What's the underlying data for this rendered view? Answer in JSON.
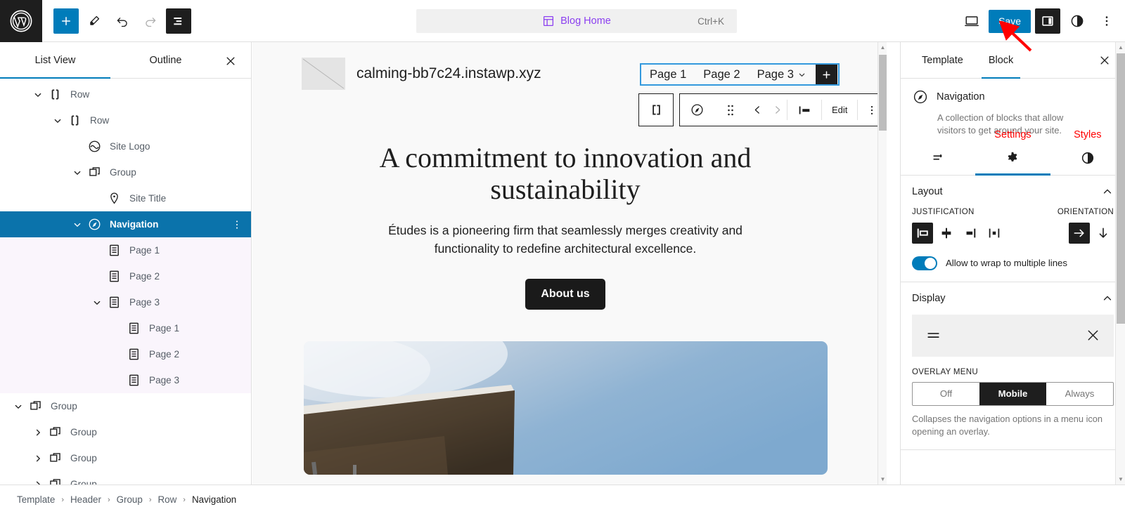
{
  "topbar": {
    "logo_icon": "wordpress-logo-icon",
    "add_block_icon": "plus-icon",
    "tools_icon": "pencil-icon",
    "undo_icon": "undo-arrow-icon",
    "redo_icon": "redo-arrow-icon",
    "list_view_icon": "list-view-icon",
    "document_title": "Blog Home",
    "document_icon": "template-layout-icon",
    "shortcut": "Ctrl+K",
    "view_icon": "desktop-preview-icon",
    "save_label": "Save",
    "settings_toggle_icon": "sidebar-panel-icon",
    "styles_icon": "contrast-half-circle-icon",
    "options_icon": "three-dots-vertical-icon",
    "accent_color": "#007cba",
    "dark_color": "#1e1e1e"
  },
  "list_view": {
    "tabs": [
      {
        "label": "List View",
        "active": true
      },
      {
        "label": "Outline",
        "active": false
      }
    ],
    "close_icon": "close-x-icon",
    "selected_color": "#0b73ab",
    "child_highlight_color": "#faf5fc",
    "rows": [
      {
        "label": "Row",
        "icon": "row-block-icon",
        "indent": 1,
        "chevron": "down",
        "state": "normal"
      },
      {
        "label": "Row",
        "icon": "row-block-icon",
        "indent": 2,
        "chevron": "down",
        "state": "normal"
      },
      {
        "label": "Site Logo",
        "icon": "site-logo-icon",
        "indent": 3,
        "chevron": "none",
        "state": "normal"
      },
      {
        "label": "Group",
        "icon": "group-block-icon",
        "indent": 3,
        "chevron": "down",
        "state": "normal"
      },
      {
        "label": "Site Title",
        "icon": "site-title-pin-icon",
        "indent": 4,
        "chevron": "none",
        "state": "normal"
      },
      {
        "label": "Navigation",
        "icon": "navigation-compass-icon",
        "indent": 3,
        "chevron": "down",
        "state": "selected",
        "more_icon": "three-dots-vertical-icon"
      },
      {
        "label": "Page 1",
        "icon": "page-document-icon",
        "indent": 4,
        "chevron": "none",
        "state": "childsel"
      },
      {
        "label": "Page 2",
        "icon": "page-document-icon",
        "indent": 4,
        "chevron": "none",
        "state": "childsel"
      },
      {
        "label": "Page 3",
        "icon": "page-document-icon",
        "indent": 4,
        "chevron": "down",
        "state": "childsel"
      },
      {
        "label": "Page 1",
        "icon": "page-document-icon",
        "indent": 5,
        "chevron": "none",
        "state": "childsel"
      },
      {
        "label": "Page 2",
        "icon": "page-document-icon",
        "indent": 5,
        "chevron": "none",
        "state": "childsel"
      },
      {
        "label": "Page 3",
        "icon": "page-document-icon",
        "indent": 5,
        "chevron": "none",
        "state": "childsel"
      },
      {
        "label": "Group",
        "icon": "group-block-icon",
        "indent": 0,
        "chevron": "down",
        "state": "normal"
      },
      {
        "label": "Group",
        "icon": "group-block-icon",
        "indent": 1,
        "chevron": "right",
        "state": "normal"
      },
      {
        "label": "Group",
        "icon": "group-block-icon",
        "indent": 1,
        "chevron": "right",
        "state": "normal"
      },
      {
        "label": "Group",
        "icon": "group-block-icon",
        "indent": 1,
        "chevron": "right",
        "state": "normal"
      }
    ]
  },
  "canvas": {
    "site_title": "calming-bb7c24.instawp.xyz",
    "site_logo_icon": "placeholder-image-icon",
    "nav": {
      "items": [
        "Page 1",
        "Page 2",
        "Page 3"
      ],
      "submenu_chevron_on": "Page 3",
      "add_icon": "plus-icon",
      "selection_color": "#3399dd"
    },
    "block_toolbar": {
      "parent_icon": "row-block-icon",
      "block_icon": "navigation-compass-icon",
      "drag_icon": "drag-handle-dots-icon",
      "move_up_icon": "chevron-left-icon",
      "move_down_icon": "chevron-right-icon",
      "align_icon": "align-left-icon",
      "edit_label": "Edit",
      "options_icon": "three-dots-vertical-icon"
    },
    "heading": "A commitment to innovation and sustainability",
    "paragraph": "Études is a pioneering firm that seamlessly merges creativity and functionality to redefine architectural excellence.",
    "cta_label": "About us",
    "image_alt": "architectural-canopy-photo"
  },
  "inspector": {
    "tabs": [
      {
        "label": "Template",
        "active": false
      },
      {
        "label": "Block",
        "active": true
      }
    ],
    "close_icon": "close-x-icon",
    "block": {
      "icon": "navigation-compass-icon",
      "title": "Navigation",
      "description": "A collection of blocks that allow visitors to get around your site."
    },
    "inspector_tabs": [
      {
        "icon": "list-settings-icon",
        "label": "",
        "active": false
      },
      {
        "icon": "gear-icon",
        "label": "Settings",
        "active": true
      },
      {
        "icon": "contrast-half-circle-icon",
        "label": "Styles",
        "active": false
      }
    ],
    "annotation_color": "#ff0000",
    "layout_panel": {
      "title": "Layout",
      "collapse_icon": "chevron-up-icon",
      "justification_label": "JUSTIFICATION",
      "justification_options": [
        {
          "icon": "justify-left-icon",
          "selected": true
        },
        {
          "icon": "justify-center-icon",
          "selected": false
        },
        {
          "icon": "justify-right-icon",
          "selected": false
        },
        {
          "icon": "justify-space-between-icon",
          "selected": false
        }
      ],
      "orientation_label": "ORIENTATION",
      "orientation_options": [
        {
          "icon": "arrow-right-icon",
          "selected": true
        },
        {
          "icon": "arrow-down-icon",
          "selected": false
        }
      ],
      "wrap_toggle_label": "Allow to wrap to multiple lines",
      "wrap_toggle_on": true
    },
    "display_panel": {
      "title": "Display",
      "collapse_icon": "chevron-up-icon",
      "preview_open_icon": "hamburger-menu-icon",
      "preview_close_icon": "close-x-icon",
      "overlay_label": "OVERLAY MENU",
      "overlay_options": [
        {
          "label": "Off",
          "selected": false
        },
        {
          "label": "Mobile",
          "selected": true
        },
        {
          "label": "Always",
          "selected": false
        }
      ],
      "help_text": "Collapses the navigation options in a menu icon opening an overlay."
    }
  },
  "breadcrumb": {
    "items": [
      "Template",
      "Header",
      "Group",
      "Row",
      "Navigation"
    ],
    "separator": "›"
  }
}
